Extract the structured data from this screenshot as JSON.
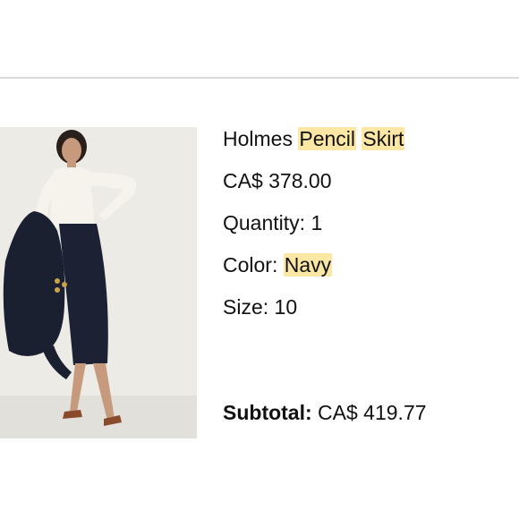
{
  "product": {
    "name_part1": "Holmes",
    "name_part2": "Pencil",
    "name_part3": "Skirt",
    "price": "CA$ 378.00",
    "quantity_label": "Quantity:",
    "quantity_value": "1",
    "color_label": "Color:",
    "color_value": "Navy",
    "size_label": "Size:",
    "size_value": "10",
    "image_icon": "product-photo"
  },
  "summary": {
    "subtotal_label": "Subtotal:",
    "subtotal_value": "CA$ 419.77"
  },
  "colors": {
    "highlight": "#fde7a4",
    "navy": "#1c2233",
    "background": "#ffffff",
    "divider": "#dcdcdc"
  }
}
